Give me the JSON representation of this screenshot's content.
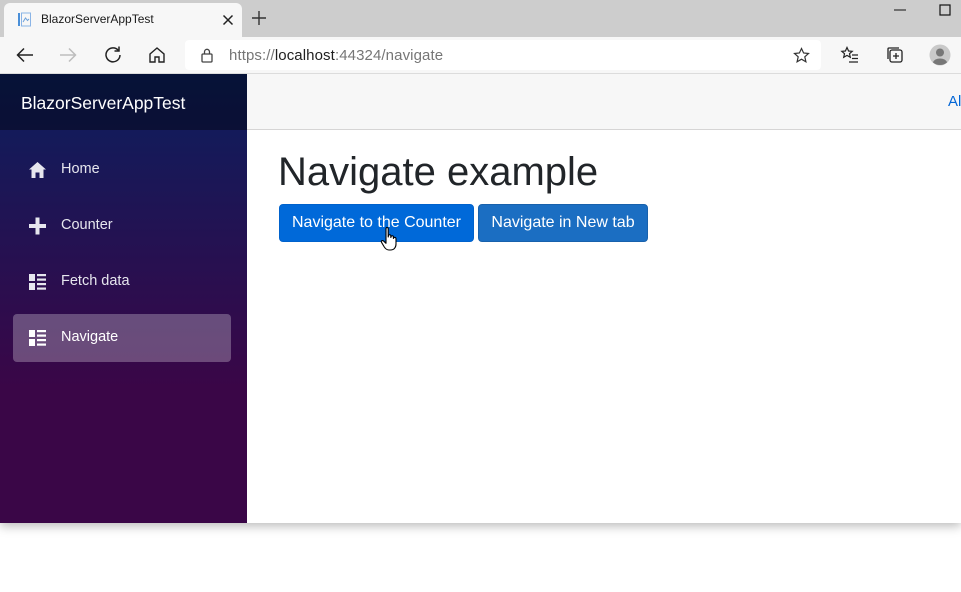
{
  "browser": {
    "tab": {
      "title": "BlazorServerAppTest"
    },
    "address_bar": {
      "scheme": "https://",
      "host": "localhost",
      "rest": ":44324/navigate"
    },
    "icons": {
      "back": "arrow-left-icon",
      "forward": "arrow-right-icon",
      "refresh": "refresh-icon",
      "home": "home-icon",
      "lock": "lock-icon",
      "favorite": "star-icon",
      "favorites": "favorites-list-icon",
      "collections": "collections-icon",
      "profile": "profile-icon",
      "minimize": "minimize-icon",
      "maximize": "maximize-icon",
      "close_tab": "close-icon",
      "new_tab": "plus-icon"
    }
  },
  "app": {
    "brand": "BlazorServerAppTest",
    "nav": [
      {
        "label": "Home",
        "icon": "home-icon",
        "active": false
      },
      {
        "label": "Counter",
        "icon": "plus-icon",
        "active": false
      },
      {
        "label": "Fetch data",
        "icon": "list-rich-icon",
        "active": false
      },
      {
        "label": "Navigate",
        "icon": "list-rich-icon",
        "active": true
      }
    ],
    "top_row": {
      "link_text": "Al"
    },
    "content": {
      "heading": "Navigate example",
      "buttons": {
        "counter": "Navigate to the Counter",
        "new_tab": "Navigate in New tab"
      }
    }
  },
  "colors": {
    "sidebar_top": "#0b1f5e",
    "sidebar_bottom": "#3a0647",
    "primary_button": "#0069d9",
    "secondary_button": "#1b6ec2",
    "link": "#0366d6"
  }
}
